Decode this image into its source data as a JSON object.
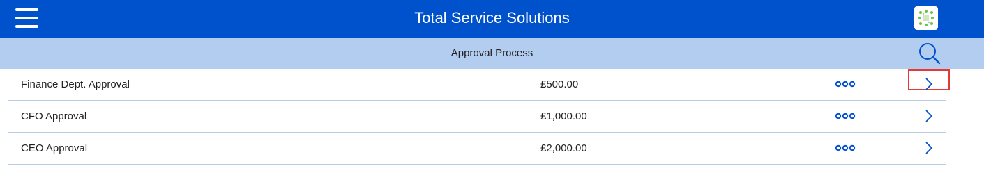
{
  "header": {
    "title": "Total Service Solutions",
    "menu_icon": "hamburger-menu-icon",
    "logo_icon": "app-logo-icon",
    "background_color": "#0052cc"
  },
  "subheader": {
    "title": "Approval Process",
    "search_icon": "search-icon",
    "background_color": "#b3cdf0"
  },
  "approvals": [
    {
      "name": "Finance Dept. Approval",
      "amount": "£500.00",
      "highlighted": true
    },
    {
      "name": "CFO Approval",
      "amount": "£1,000.00",
      "highlighted": false
    },
    {
      "name": "CEO Approval",
      "amount": "£2,000.00",
      "highlighted": false
    }
  ],
  "row_icons": {
    "more": "more-options-icon",
    "open": "chevron-right-icon"
  },
  "colors": {
    "accent": "#0052cc",
    "divider": "#b8cce4",
    "highlight": "#e53935"
  }
}
